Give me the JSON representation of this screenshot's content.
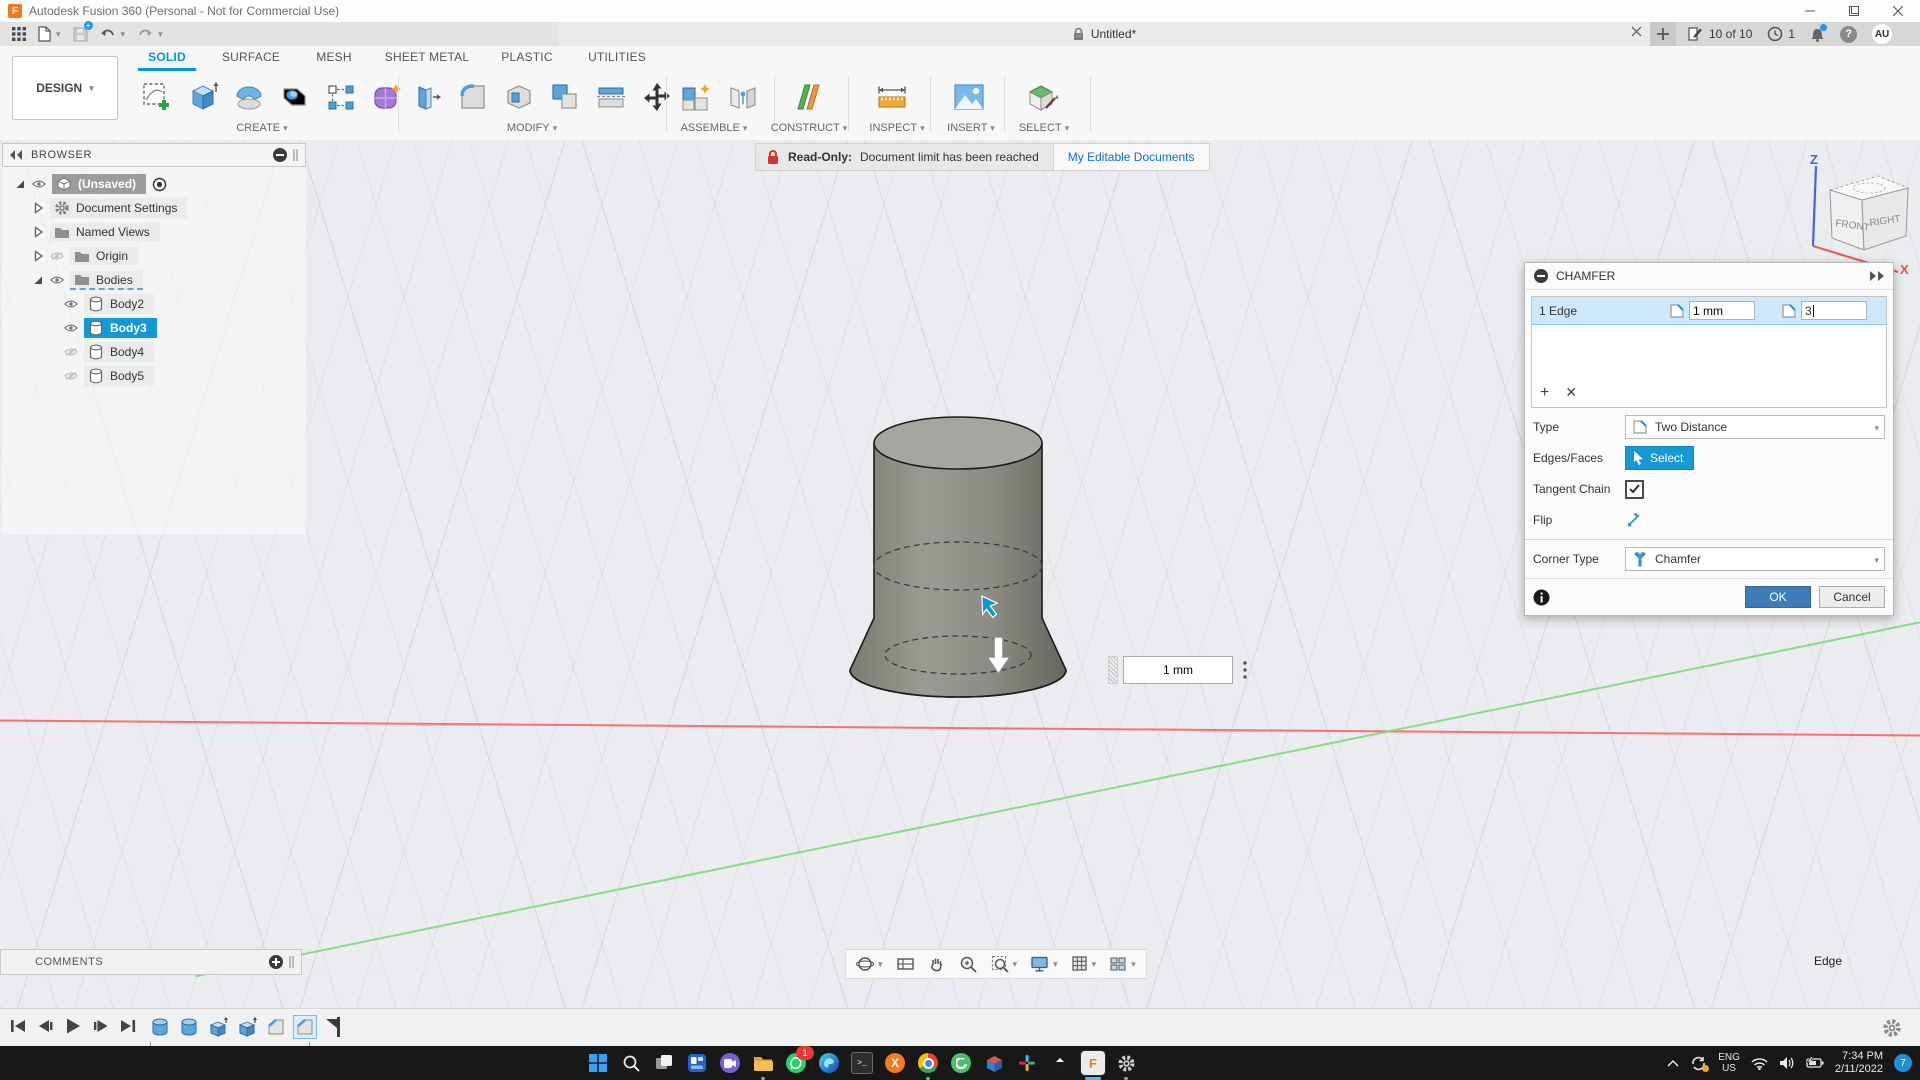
{
  "title_bar": {
    "app_title": "Autodesk Fusion 360 (Personal - Not for Commercial Use)"
  },
  "tab_strip": {
    "document_title": "Untitled*",
    "documents_count": "10 of 10",
    "jobs_count": "1",
    "help_glyph": "?",
    "avatar_initials": "AU"
  },
  "ribbon": {
    "workspace_label": "DESIGN",
    "tabs": [
      {
        "label": "SOLID",
        "active": true
      },
      {
        "label": "SURFACE"
      },
      {
        "label": "MESH"
      },
      {
        "label": "SHEET METAL"
      },
      {
        "label": "PLASTIC"
      },
      {
        "label": "UTILITIES"
      }
    ],
    "groups": [
      {
        "label": "CREATE"
      },
      {
        "label": "MODIFY"
      },
      {
        "label": "ASSEMBLE"
      },
      {
        "label": "CONSTRUCT"
      },
      {
        "label": "INSPECT"
      },
      {
        "label": "INSERT"
      },
      {
        "label": "SELECT"
      }
    ]
  },
  "readonly_banner": {
    "label": "Read-Only:",
    "message": "Document limit has been reached",
    "link": "My Editable Documents"
  },
  "browser": {
    "title": "BROWSER",
    "rows": [
      {
        "label": "(Unsaved)",
        "root": true
      },
      {
        "label": "Document Settings"
      },
      {
        "label": "Named Views"
      },
      {
        "label": "Origin",
        "hidden": true
      },
      {
        "label": "Bodies"
      },
      {
        "label": "Body2"
      },
      {
        "label": "Body3",
        "selected": true
      },
      {
        "label": "Body4",
        "hidden": true
      },
      {
        "label": "Body5",
        "hidden": true
      }
    ]
  },
  "viewcube": {
    "front": "FRONT",
    "right": "RIGHT",
    "axis_z": "Z",
    "axis_x": "X"
  },
  "chamfer_dialog": {
    "title": "CHAMFER",
    "selection_row": {
      "label": "1 Edge",
      "distance_1": "1 mm",
      "distance_2": "3"
    },
    "add_glyph": "+",
    "remove_glyph": "✕",
    "type_label": "Type",
    "type_value": "Two Distance",
    "edges_label": "Edges/Faces",
    "select_button": "Select",
    "tangent_label": "Tangent Chain",
    "tangent_checked": true,
    "flip_label": "Flip",
    "corner_label": "Corner Type",
    "corner_value": "Chamfer",
    "ok_label": "OK",
    "cancel_label": "Cancel"
  },
  "canvas": {
    "floating_input_value": "1 mm",
    "status_text": "Edge"
  },
  "comments": {
    "title": "COMMENTS"
  },
  "colors": {
    "accent_blue": "#0696d7",
    "selection_blue": "#1499d6",
    "ok_blue": "#3e7cb8",
    "readonly_red": "#d63430",
    "axis_red": "#ff5a5a",
    "axis_green": "#7ad67a"
  },
  "taskbar": {
    "whatsapp_badge": "1",
    "terminal_glyph": ">_",
    "xampp_glyph": "X",
    "fusion_glyph": "F",
    "language_line1": "ENG",
    "language_line2": "US",
    "time": "7:34 PM",
    "date": "2/11/2022",
    "notification_badge": "7"
  }
}
